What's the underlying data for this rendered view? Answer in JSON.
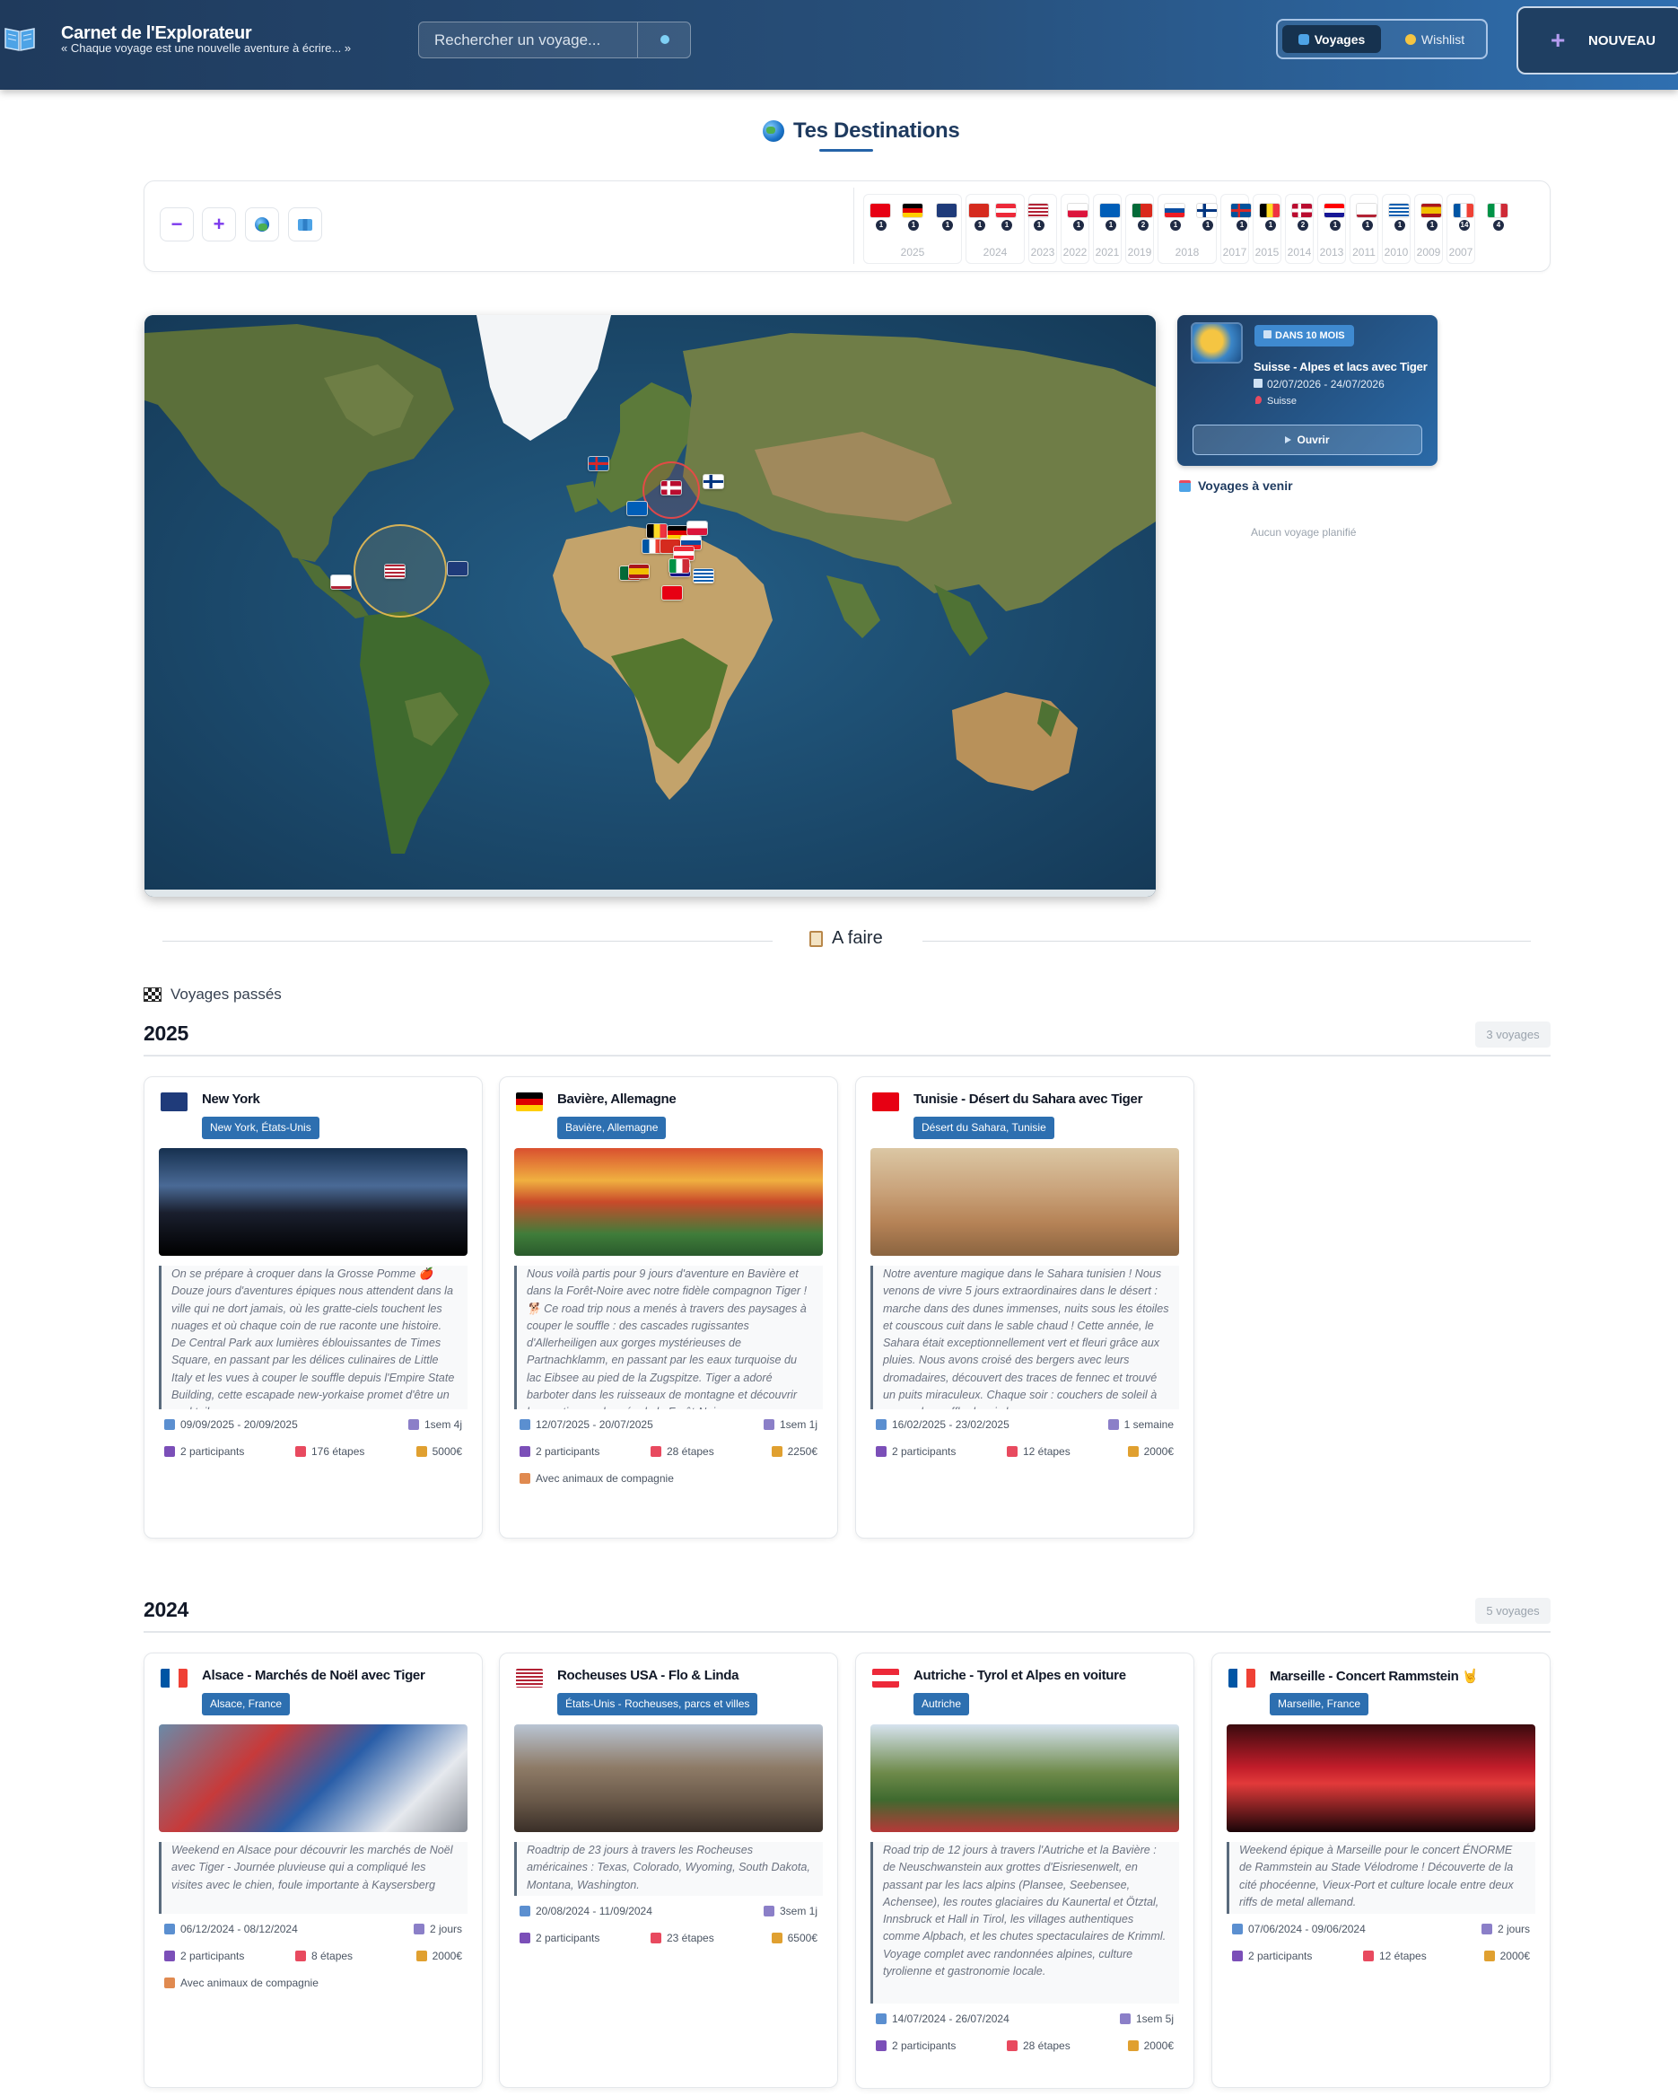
{
  "header": {
    "title": "Carnet de l'Explorateur",
    "subtitle": "« Chaque voyage est une nouvelle aventure à écrire... »",
    "search_placeholder": "Rechercher un voyage...",
    "tab_voyages": "Voyages",
    "tab_wishlist": "Wishlist",
    "new_label": "NOUVEAU"
  },
  "destinations": {
    "title": "Tes Destinations",
    "controls": [
      "zoom-out",
      "zoom-in",
      "globe",
      "map"
    ],
    "timeline": [
      {
        "flag": "tunisia",
        "count": "1"
      },
      {
        "flag": "germany",
        "count": "1"
      },
      {
        "flag": "new-york",
        "count": "1"
      },
      {
        "flag": "switzerland",
        "count": "1"
      },
      {
        "flag": "austria",
        "count": "1"
      },
      {
        "flag": "usa",
        "count": "1"
      },
      {
        "flag": "poland",
        "count": "1"
      },
      {
        "flag": "scotland",
        "count": "1"
      },
      {
        "flag": "portugal",
        "count": "2"
      },
      {
        "flag": "slovakia",
        "count": "1"
      },
      {
        "flag": "finland",
        "count": "1"
      },
      {
        "flag": "iceland",
        "count": "1"
      },
      {
        "flag": "belgium",
        "count": "1"
      },
      {
        "flag": "norway",
        "count": "2"
      },
      {
        "flag": "croatia",
        "count": "1"
      },
      {
        "flag": "california",
        "count": "1"
      },
      {
        "flag": "greece",
        "count": "1"
      },
      {
        "flag": "spain",
        "count": "1"
      },
      {
        "flag": "france",
        "count": "14"
      },
      {
        "flag": "italy",
        "count": "4"
      }
    ],
    "years": [
      "2025",
      "2024",
      "2023",
      "2022",
      "2021",
      "2019",
      "2018",
      "2017",
      "2015",
      "2014",
      "2013",
      "2011",
      "2010",
      "2009",
      "2007"
    ]
  },
  "upcoming": {
    "badge": "DANS 10 MOIS",
    "title": "Suisse - Alpes et lacs avec Tiger",
    "dates": "02/07/2026 - 24/07/2026",
    "location": "Suisse",
    "open_label": "Ouvrir",
    "section_title": "Voyages à venir",
    "empty_text": "Aucun voyage planifié"
  },
  "afaire": {
    "label": "A faire"
  },
  "past": {
    "title": "Voyages passés",
    "years": [
      {
        "year": "2025",
        "count": "3 voyages",
        "cards": [
          {
            "title": "New York",
            "location": "New York, États-Unis",
            "flag": "new-york",
            "description": "On se prépare à croquer dans la Grosse Pomme 🍎 Douze jours d'aventures épiques nous attendent dans la ville qui ne dort jamais, où les gratte-ciels touchent les nuages et où chaque coin de rue raconte une histoire. De Central Park aux lumières éblouissantes de Times Square, en passant par les délices culinaires de Little Italy et les vues à couper le souffle depuis l'Empire State Building, cette escapade new-yorkaise promet d'être un cocktail",
            "dates": "09/09/2025 - 20/09/2025",
            "duration": "1sem 4j",
            "participants": "2 participants",
            "steps": "176 étapes",
            "budget": "5000€",
            "pets": ""
          },
          {
            "title": "Bavière, Allemagne",
            "location": "Bavière, Allemagne",
            "flag": "germany",
            "description": "Nous voilà partis pour 9 jours d'aventure en Bavière et dans la Forêt-Noire avec notre fidèle compagnon Tiger ! 🐕 Ce road trip nous a menés à travers des paysages à couper le souffle : des cascades rugissantes d'Allerheiligen aux gorges mystérieuses de Partnachklamm, en passant par les eaux turquoise du lac Eibsee au pied de la Zugspitze. Tiger a adoré barboter dans les ruisseaux de montagne et découvrir les sentiers ombragés de la Forêt-Noire.",
            "dates": "12/07/2025 - 20/07/2025",
            "duration": "1sem 1j",
            "participants": "2 participants",
            "steps": "28 étapes",
            "budget": "2250€",
            "pets": "Avec animaux de compagnie"
          },
          {
            "title": "Tunisie - Désert du Sahara avec Tiger",
            "location": "Désert du Sahara, Tunisie",
            "flag": "tunisia",
            "description": "Notre aventure magique dans le Sahara tunisien ! Nous venons de vivre 5 jours extraordinaires dans le désert : marche dans des dunes immenses, nuits sous les étoiles et couscous cuit dans le sable chaud ! Cette année, le Sahara était exceptionnellement vert et fleuri grâce aux pluies. Nous avons croisé des bergers avec leurs dromadaires, découvert des traces de fennec et trouvé un puits miraculeux. Chaque soir : couchers de soleil à couper le souffle depuis les",
            "dates": "16/02/2025 - 23/02/2025",
            "duration": "1 semaine",
            "participants": "2 participants",
            "steps": "12 étapes",
            "budget": "2000€",
            "pets": ""
          }
        ]
      },
      {
        "year": "2024",
        "count": "5 voyages",
        "cards": [
          {
            "title": "Alsace - Marchés de Noël avec Tiger",
            "location": "Alsace, France",
            "flag": "france",
            "description": "Weekend en Alsace pour découvrir les marchés de Noël avec Tiger - Journée pluvieuse qui a compliqué les visites avec le chien, foule importante à Kaysersberg",
            "dates": "06/12/2024 - 08/12/2024",
            "duration": "2 jours",
            "participants": "2 participants",
            "steps": "8 étapes",
            "budget": "2000€",
            "pets": "Avec animaux de compagnie"
          },
          {
            "title": "Rocheuses USA - Flo & Linda",
            "location": "États-Unis - Rocheuses, parcs et villes",
            "flag": "usa",
            "description": "Roadtrip de 23 jours à travers les Rocheuses américaines : Texas, Colorado, Wyoming, South Dakota, Montana, Washington.",
            "dates": "20/08/2024 - 11/09/2024",
            "duration": "3sem 1j",
            "participants": "2 participants",
            "steps": "23 étapes",
            "budget": "6500€",
            "pets": ""
          },
          {
            "title": "Autriche - Tyrol et Alpes en voiture",
            "location": "Autriche",
            "flag": "austria",
            "description": "Road trip de 12 jours à travers l'Autriche et la Bavière : de Neuschwanstein aux grottes d'Eisriesenwelt, en passant par les lacs alpins (Plansee, Seebensee, Achensee), les routes glaciaires du Kaunertal et Ötztal, Innsbruck et Hall in Tirol, les villages authentiques comme Alpbach, et les chutes spectaculaires de Krimml. Voyage complet avec randonnées alpines, culture tyrolienne et gastronomie locale.",
            "dates": "14/07/2024 - 26/07/2024",
            "duration": "1sem 5j",
            "participants": "2 participants",
            "steps": "28 étapes",
            "budget": "2000€",
            "pets": ""
          },
          {
            "title": "Marseille - Concert Rammstein 🤘",
            "location": "Marseille, France",
            "flag": "france",
            "description": "Weekend épique à Marseille pour le concert ÉNORME de Rammstein au Stade Vélodrome ! Découverte de la cité phocéenne, Vieux-Port et culture locale entre deux riffs de metal allemand.",
            "dates": "07/06/2024 - 09/06/2024",
            "duration": "2 jours",
            "participants": "2 participants",
            "steps": "12 étapes",
            "budget": "2000€",
            "pets": ""
          }
        ]
      }
    ]
  },
  "colors": {
    "header_dark": "#1f3a5c",
    "header_light": "#2f6fb0",
    "location_tag": "#2d6fb0",
    "accent": "#7c3aed"
  }
}
